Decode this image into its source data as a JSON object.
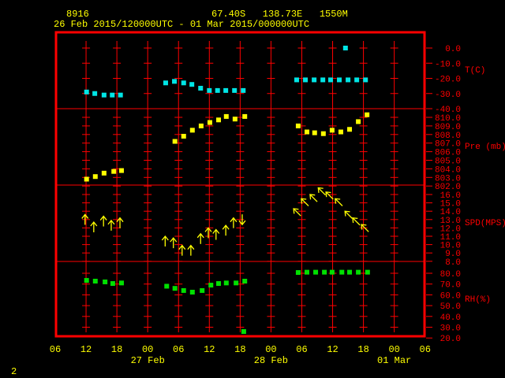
{
  "header": {
    "station_id": "8916",
    "location": "67.40S   138.73E   1550M",
    "period": "26 Feb 2015/120000UTC - 01 Mar 2015/000000UTC"
  },
  "footer": {
    "page_number": "2"
  },
  "colors": {
    "frame": "#ff0000",
    "text": "#ffff00",
    "temperature": "#00e5e5",
    "pressure": "#ffff00",
    "wind": "#ffff00",
    "humidity": "#00e000"
  },
  "chart_data": {
    "type": "scatter",
    "x_axis": {
      "unit": "hours from axis start",
      "range": [
        0,
        72
      ],
      "tick_labels": [
        "06",
        "12",
        "18",
        "00",
        "06",
        "12",
        "18",
        "00",
        "06",
        "12",
        "18",
        "00",
        "06"
      ],
      "date_labels": [
        {
          "label": "27 Feb",
          "at_hour": 18
        },
        {
          "label": "28 Feb",
          "at_hour": 42
        },
        {
          "label": "01 Mar",
          "at_hour": 66
        }
      ]
    },
    "panels": [
      {
        "name": "temperature",
        "label": "T(C)",
        "range": [
          -40,
          0
        ],
        "tick_labels": [
          "0.0",
          "-10.0",
          "-20.0",
          "-30.0",
          "-40.0"
        ],
        "tick_values": [
          0,
          -10,
          -20,
          -30,
          -40
        ],
        "points": [
          [
            6.1,
            -29
          ],
          [
            7.7,
            -30
          ],
          [
            9.5,
            -31
          ],
          [
            11.1,
            -31
          ],
          [
            12.7,
            -31
          ],
          [
            21.5,
            -23
          ],
          [
            23.2,
            -22
          ],
          [
            25.0,
            -23
          ],
          [
            26.6,
            -24
          ],
          [
            28.3,
            -26.5
          ],
          [
            30.0,
            -28
          ],
          [
            31.6,
            -28
          ],
          [
            33.2,
            -28
          ],
          [
            34.9,
            -28
          ],
          [
            36.6,
            -28
          ],
          [
            47.0,
            -21
          ],
          [
            48.7,
            -21
          ],
          [
            50.4,
            -21
          ],
          [
            52.1,
            -21
          ],
          [
            53.6,
            -21
          ],
          [
            55.3,
            -21
          ],
          [
            56.5,
            0
          ],
          [
            57.0,
            -21
          ],
          [
            58.7,
            -21
          ],
          [
            60.4,
            -21
          ]
        ]
      },
      {
        "name": "pressure",
        "label": "Pre (mb)",
        "range": [
          802,
          810
        ],
        "tick_labels": [
          "810.0",
          "809.0",
          "808.0",
          "807.0",
          "806.0",
          "805.0",
          "804.0",
          "803.0",
          "802.0"
        ],
        "tick_values": [
          810,
          809,
          808,
          807,
          806,
          805,
          804,
          803,
          802
        ],
        "points": [
          [
            6.1,
            802.8
          ],
          [
            7.8,
            803.1
          ],
          [
            9.5,
            803.5
          ],
          [
            11.4,
            803.7
          ],
          [
            12.9,
            803.8
          ],
          [
            23.3,
            807.2
          ],
          [
            25.0,
            807.8
          ],
          [
            26.7,
            808.5
          ],
          [
            28.4,
            809.0
          ],
          [
            30.1,
            809.4
          ],
          [
            31.8,
            809.7
          ],
          [
            33.3,
            810.1
          ],
          [
            35.0,
            809.8
          ],
          [
            36.9,
            810.1
          ],
          [
            47.3,
            809.0
          ],
          [
            49.0,
            808.3
          ],
          [
            50.5,
            808.2
          ],
          [
            52.2,
            808.1
          ],
          [
            53.9,
            808.5
          ],
          [
            55.6,
            808.3
          ],
          [
            57.3,
            808.6
          ],
          [
            59.0,
            809.5
          ],
          [
            60.7,
            810.3
          ]
        ]
      },
      {
        "name": "wind-speed",
        "label": "SPD(MPS)",
        "range": [
          8,
          16
        ],
        "tick_labels": [
          "16.0",
          "15.0",
          "14.0",
          "13.0",
          "12.0",
          "11.0",
          "10.0",
          "9.0",
          "8.0"
        ],
        "tick_values": [
          16,
          15,
          14,
          13,
          12,
          11,
          10,
          9,
          8
        ],
        "points": [
          [
            5.8,
            13.6,
            0
          ],
          [
            7.5,
            12.7,
            0
          ],
          [
            9.4,
            13.4,
            0
          ],
          [
            10.9,
            12.9,
            0
          ],
          [
            12.6,
            13.2,
            0
          ],
          [
            21.4,
            11,
            0
          ],
          [
            23.0,
            10.8,
            0
          ],
          [
            24.7,
            9.9,
            0
          ],
          [
            26.4,
            9.9,
            0
          ],
          [
            28.3,
            11.3,
            0
          ],
          [
            29.8,
            12,
            0
          ],
          [
            31.3,
            11.8,
            0
          ],
          [
            33.2,
            12.3,
            0
          ],
          [
            34.7,
            13.2,
            0
          ],
          [
            36.4,
            12.4,
            180
          ],
          [
            46.4,
            14.3,
            -45
          ],
          [
            47.9,
            15.5,
            -45
          ],
          [
            49.6,
            16,
            -45
          ],
          [
            51.2,
            16.8,
            -45
          ],
          [
            52.7,
            16.3,
            -45
          ],
          [
            54.5,
            15.5,
            -45
          ],
          [
            56.4,
            14,
            -45
          ],
          [
            57.9,
            13.2,
            -45
          ],
          [
            59.6,
            12.4,
            -45
          ]
        ]
      },
      {
        "name": "humidity",
        "label": "RH(%)",
        "range": [
          20,
          80
        ],
        "tick_labels": [
          "80.0",
          "70.0",
          "60.0",
          "50.0",
          "40.0",
          "30.0",
          "20.0"
        ],
        "tick_values": [
          80,
          70,
          60,
          50,
          40,
          30,
          20
        ],
        "points": [
          [
            6.1,
            73.4
          ],
          [
            7.8,
            72.7
          ],
          [
            9.7,
            72
          ],
          [
            11.2,
            70.5
          ],
          [
            12.9,
            71
          ],
          [
            21.7,
            68
          ],
          [
            23.3,
            66
          ],
          [
            25.0,
            64
          ],
          [
            26.7,
            62.5
          ],
          [
            28.6,
            64
          ],
          [
            30.3,
            69
          ],
          [
            31.8,
            70.5
          ],
          [
            33.3,
            71
          ],
          [
            35.2,
            71
          ],
          [
            36.7,
            26
          ],
          [
            36.9,
            72.7
          ],
          [
            47.3,
            80.7
          ],
          [
            49.0,
            81
          ],
          [
            50.7,
            81
          ],
          [
            52.4,
            81
          ],
          [
            53.9,
            81
          ],
          [
            55.8,
            81
          ],
          [
            57.3,
            81
          ],
          [
            59.0,
            81
          ],
          [
            60.8,
            81
          ]
        ]
      }
    ]
  }
}
